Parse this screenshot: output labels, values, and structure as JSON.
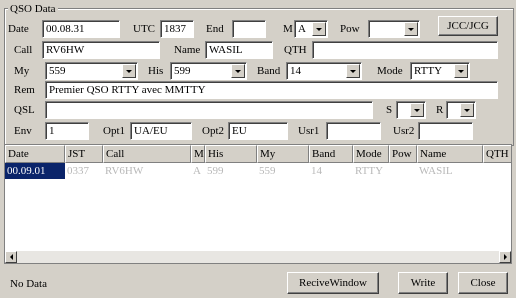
{
  "group_title": "QSO Data",
  "labels": {
    "date": "Date",
    "utc": "UTC",
    "end": "End",
    "m": "M",
    "pow": "Pow",
    "call": "Call",
    "name": "Name",
    "qth": "QTH",
    "my": "My",
    "his": "His",
    "band": "Band",
    "mode": "Mode",
    "rem": "Rem",
    "qsl": "QSL",
    "s": "S",
    "r": "R",
    "env": "Env",
    "opt1": "Opt1",
    "opt2": "Opt2",
    "usr1": "Usr1",
    "usr2": "Usr2"
  },
  "fields": {
    "date": "00.08.31",
    "utc": "1837",
    "end": "",
    "m": "A",
    "pow": "",
    "call": "RV6HW",
    "name": "WASIL",
    "qth": "",
    "my": "559",
    "his": "599",
    "band": "14",
    "mode": "RTTY",
    "rem": "Premier QSO RTTY avec MMTTY",
    "qsl": "",
    "s": "",
    "r": "",
    "env": "1",
    "opt1": "UA/EU",
    "opt2": "EU",
    "usr1": "",
    "usr2": ""
  },
  "buttons": {
    "jcc": "JCC/JCG",
    "recive_window": "ReciveWindow",
    "write": "Write",
    "close": "Close"
  },
  "grid": {
    "columns": [
      "Date",
      "JST",
      "Call",
      "M",
      "His",
      "My",
      "Band",
      "Mode",
      "Pow",
      "Name",
      "QTH"
    ],
    "rows": [
      [
        "00.09.01",
        "0337",
        "RV6HW",
        "A",
        "599",
        "559",
        "14",
        "RTTY",
        "",
        "WASIL",
        ""
      ]
    ]
  },
  "status": "No Data"
}
